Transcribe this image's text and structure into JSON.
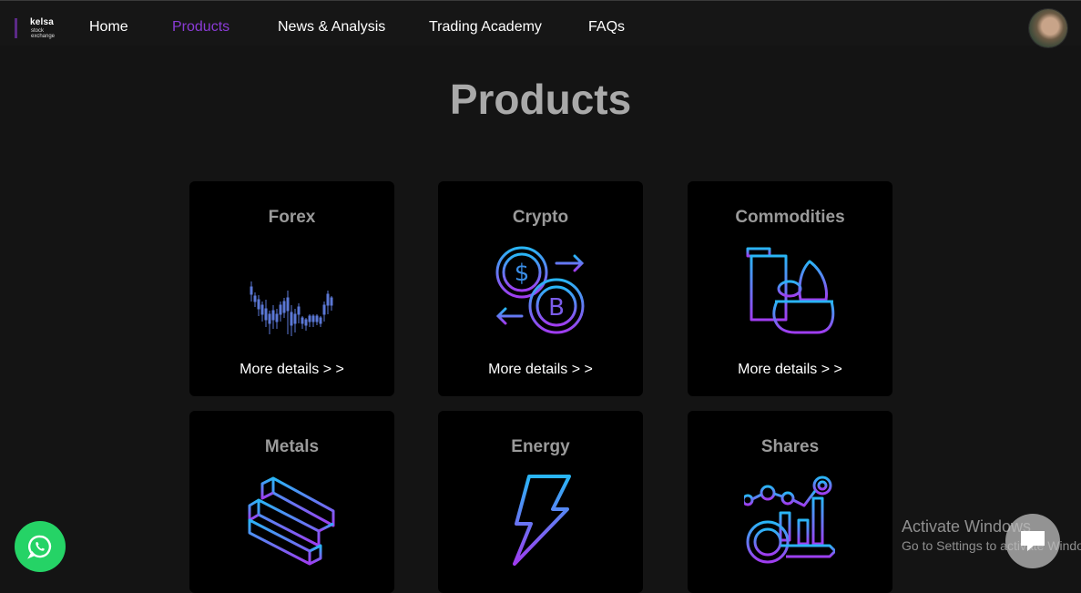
{
  "brand": {
    "name": "kelsa",
    "line1": "stock",
    "line2": "exchange"
  },
  "nav": {
    "items": [
      {
        "label": "Home",
        "active": false
      },
      {
        "label": "Products",
        "active": true
      },
      {
        "label": "News & Analysis",
        "active": false
      },
      {
        "label": "Trading Academy",
        "active": false
      },
      {
        "label": "FAQs",
        "active": false
      }
    ]
  },
  "page": {
    "title": "Products"
  },
  "products": [
    {
      "title": "Forex",
      "icon": "candlestick-chart-icon",
      "link": "More details > >"
    },
    {
      "title": "Crypto",
      "icon": "crypto-exchange-icon",
      "link": "More details > >"
    },
    {
      "title": "Commodities",
      "icon": "commodities-icon",
      "link": "More details > >"
    },
    {
      "title": "Metals",
      "icon": "metal-bars-icon",
      "link": ""
    },
    {
      "title": "Energy",
      "icon": "lightning-icon",
      "link": ""
    },
    {
      "title": "Shares",
      "icon": "shares-growth-icon",
      "link": ""
    }
  ],
  "watermark": {
    "line1": "Activate Windows",
    "line2": "Go to Settings to activate Windows."
  },
  "colors": {
    "accent": "#8a3bd6",
    "background": "#141414",
    "card": "#000000",
    "whatsapp": "#25d366"
  }
}
